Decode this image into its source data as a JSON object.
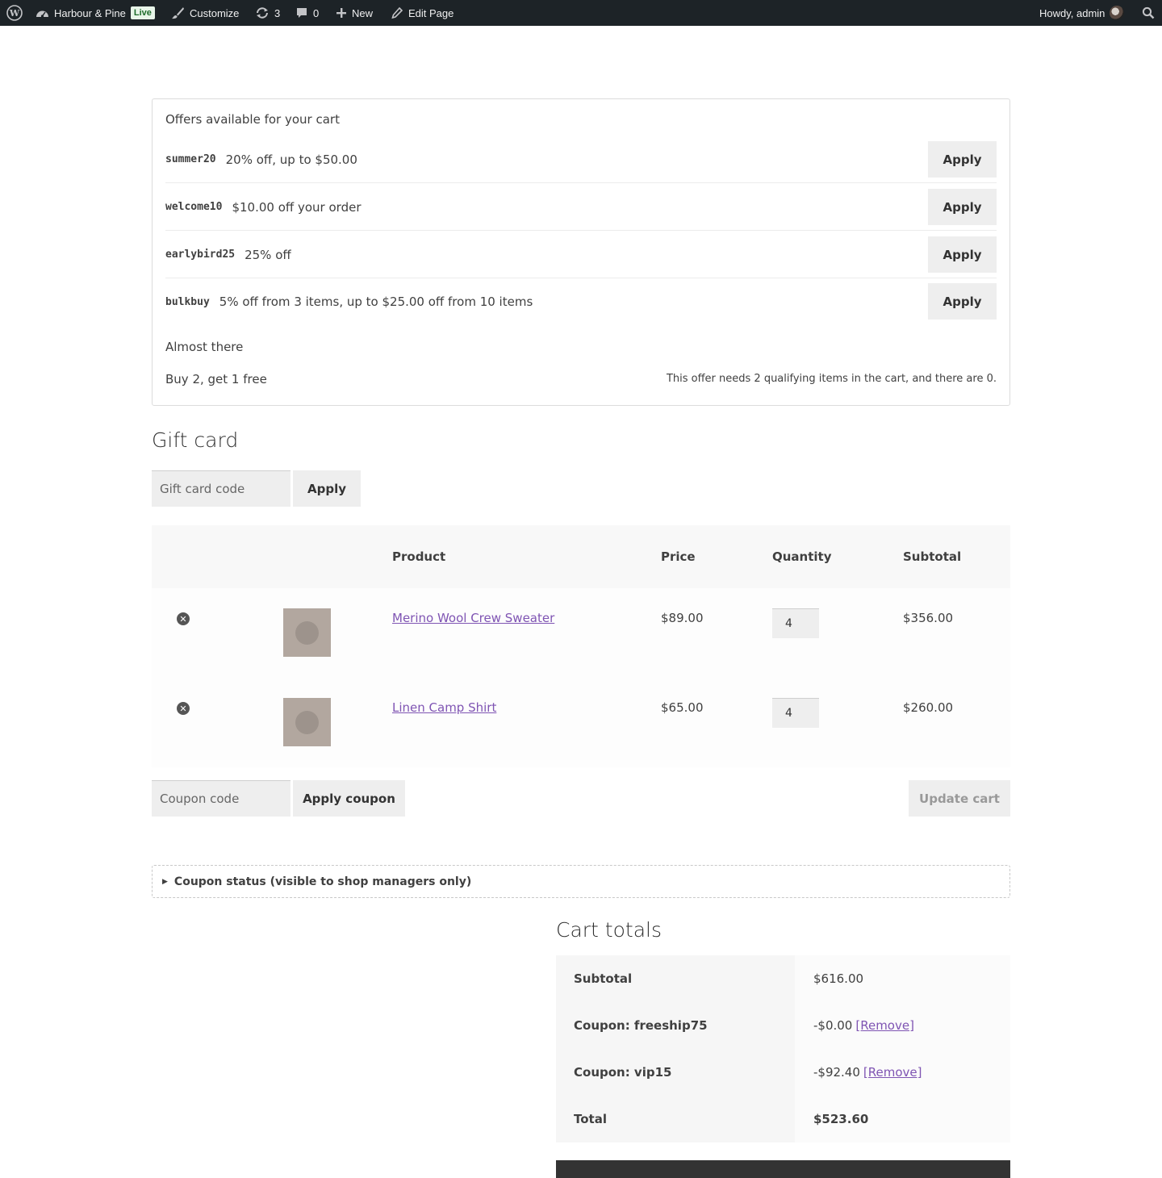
{
  "adminbar": {
    "site_name": "Harbour & Pine",
    "live_badge": "Live",
    "customize": "Customize",
    "updates_count": "3",
    "comments_count": "0",
    "new": "New",
    "edit_page": "Edit Page",
    "greeting": "Howdy, admin"
  },
  "offers": {
    "title": "Offers available for your cart",
    "items": [
      {
        "code": "summer20",
        "desc": "20% off, up to $50.00",
        "button": "Apply"
      },
      {
        "code": "welcome10",
        "desc": "$10.00 off your order",
        "button": "Apply"
      },
      {
        "code": "earlybird25",
        "desc": "25% off",
        "button": "Apply"
      },
      {
        "code": "bulkbuy",
        "desc": "5% off from 3 items, up to $25.00 off from 10 items",
        "button": "Apply"
      }
    ],
    "almost_title": "Almost there",
    "almost_offer": "Buy 2, get 1 free",
    "almost_note": "This offer needs 2 qualifying items in the cart, and there are 0."
  },
  "gift_card": {
    "title": "Gift card",
    "placeholder": "Gift card code",
    "button": "Apply"
  },
  "cart": {
    "headers": {
      "product": "Product",
      "price": "Price",
      "quantity": "Quantity",
      "subtotal": "Subtotal"
    },
    "items": [
      {
        "name": "Merino Wool Crew Sweater",
        "price": "$89.00",
        "qty": "4",
        "subtotal": "$356.00"
      },
      {
        "name": "Linen Camp Shirt",
        "price": "$65.00",
        "qty": "4",
        "subtotal": "$260.00"
      }
    ],
    "coupon_placeholder": "Coupon code",
    "apply_coupon": "Apply coupon",
    "update_cart": "Update cart"
  },
  "coupon_status": "Coupon status (visible to shop managers only)",
  "totals": {
    "title": "Cart totals",
    "subtotal_label": "Subtotal",
    "subtotal_value": "$616.00",
    "coupon1_label": "Coupon: freeship75",
    "coupon1_value": "-$0.00",
    "coupon2_label": "Coupon: vip15",
    "coupon2_value": "-$92.40",
    "remove_label": "[Remove]",
    "total_label": "Total",
    "total_value": "$523.60"
  }
}
